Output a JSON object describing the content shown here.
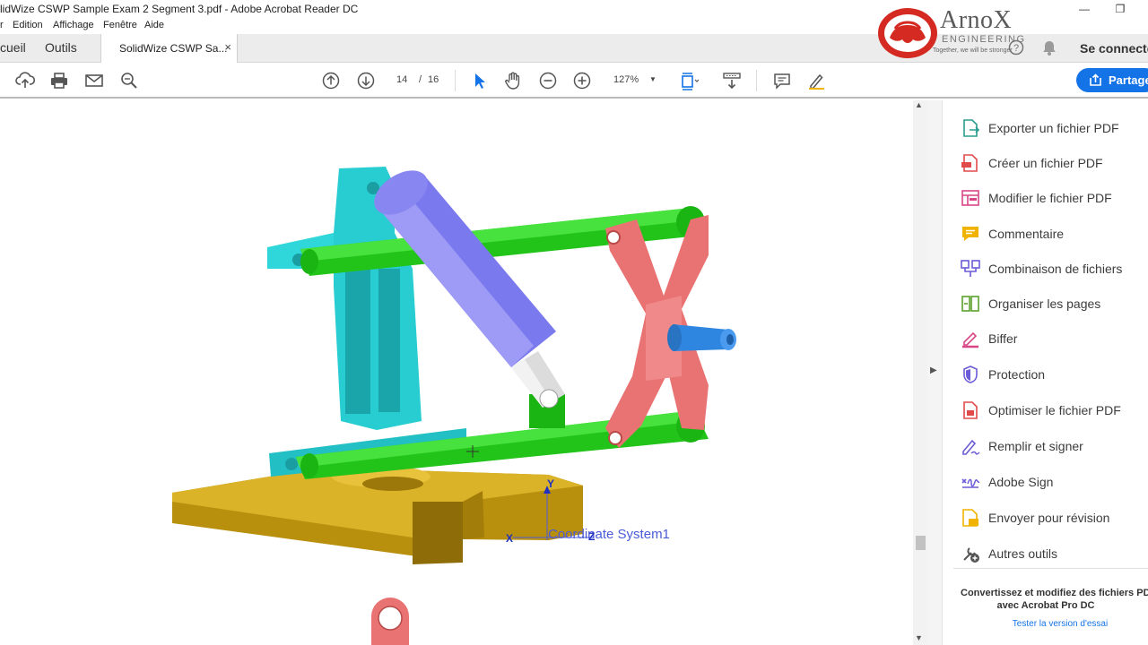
{
  "window": {
    "title": "lidWize CSWP Sample Exam 2 Segment 3.pdf - Adobe Acrobat Reader DC",
    "minimize": "—",
    "maximize": "❐"
  },
  "menu": [
    "r",
    "Edition",
    "Affichage",
    "Fenêtre",
    "Aide"
  ],
  "tabs": {
    "home": "cueil",
    "tools": "Outils",
    "document": "SolidWize CSWP Sa...",
    "close": "×",
    "sign_in": "Se connecte"
  },
  "logo": {
    "brand": "ArnoX",
    "sub": "ENGINEERING",
    "tagline": "Together, we will be stronger"
  },
  "toolbar": {
    "page_current": "14",
    "page_sep": "/",
    "page_total": "16",
    "zoom": "127%",
    "share": "Partage"
  },
  "right_panel": {
    "tools": [
      {
        "label": "Exporter un fichier PDF",
        "icon": "export-pdf-icon",
        "color": "#2a9d8f"
      },
      {
        "label": "Créer un fichier PDF",
        "icon": "create-pdf-icon",
        "color": "#e04a4a"
      },
      {
        "label": "Modifier le fichier PDF",
        "icon": "edit-pdf-icon",
        "color": "#d94686"
      },
      {
        "label": "Commentaire",
        "icon": "comment-icon",
        "color": "#f0b400"
      },
      {
        "label": "Combinaison de fichiers",
        "icon": "combine-files-icon",
        "color": "#6b5bd6"
      },
      {
        "label": "Organiser les pages",
        "icon": "organize-pages-icon",
        "color": "#5aa02c"
      },
      {
        "label": "Biffer",
        "icon": "redact-icon",
        "color": "#d94686"
      },
      {
        "label": "Protection",
        "icon": "protect-icon",
        "color": "#6b5bd6"
      },
      {
        "label": "Optimiser le fichier PDF",
        "icon": "optimize-pdf-icon",
        "color": "#e04a4a"
      },
      {
        "label": "Remplir et signer",
        "icon": "fill-sign-icon",
        "color": "#6b5bd6"
      },
      {
        "label": "Adobe Sign",
        "icon": "adobe-sign-icon",
        "color": "#6b5bd6"
      },
      {
        "label": "Envoyer pour révision",
        "icon": "send-review-icon",
        "color": "#f0b400"
      },
      {
        "label": "Autres outils",
        "icon": "more-tools-icon",
        "color": "#555555"
      }
    ],
    "promo_line1": "Convertissez et modifiez des fichiers PD",
    "promo_line2": "avec Acrobat Pro DC",
    "trial_link": "Tester la version d'essai"
  },
  "model": {
    "coord_label": "Coordinate System1",
    "axis_x": "X",
    "axis_y": "Y",
    "axis_z": "Z"
  },
  "colors": {
    "accent": "#1473e6",
    "frame": "#28d4d8",
    "links": "#21c21a",
    "cylinder": "#7a78ee",
    "bracket": "#e86e6e",
    "base": "#c9a011",
    "pin": "#2f86e0"
  }
}
